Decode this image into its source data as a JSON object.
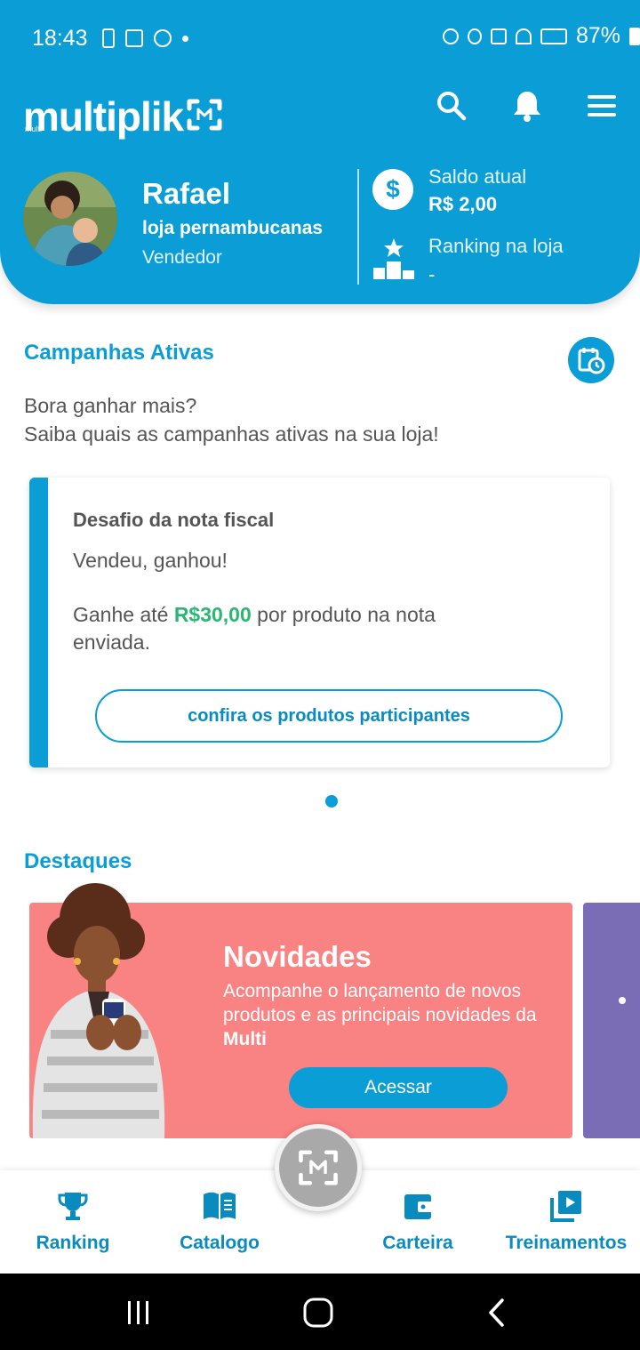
{
  "status_bar": {
    "time": "18:43",
    "battery": "87%"
  },
  "header": {
    "logo_text": "multiplik",
    "logo_sub": "multi",
    "user": {
      "name": "Rafael",
      "store": "loja pernambucanas",
      "role": "Vendedor"
    },
    "balance": {
      "label": "Saldo atual",
      "value": "R$ 2,00",
      "icon_glyph": "$"
    },
    "ranking": {
      "label": "Ranking na loja",
      "value": "-"
    },
    "colors": {
      "primary": "#0a9dd6"
    }
  },
  "campaigns": {
    "title": "Campanhas Ativas",
    "intro_line1": "Bora ganhar mais?",
    "intro_line2": "Saiba quais as campanhas ativas na sua loja!",
    "card": {
      "title": "Desafio da nota fiscal",
      "subtitle": "Vendeu, ganhou!",
      "desc_prefix": "Ganhe até ",
      "desc_highlight": "R$30,00",
      "desc_suffix": " por produto na nota enviada.",
      "button_label": "confira os produtos participantes",
      "highlight_color": "#2bb673"
    },
    "pager": {
      "current": 1,
      "total": 1
    }
  },
  "highlights": {
    "title": "Destaques",
    "banner": {
      "title": "Novidades",
      "desc_prefix": "Acompanhe o lançamento de novos produtos e as principais novidades da ",
      "desc_bold": "Multi",
      "button_label": "Acessar",
      "color": "#f98283"
    },
    "next_banner_color": "#7a6db5"
  },
  "bottom_nav": {
    "items": [
      {
        "label": "Ranking",
        "icon": "trophy-icon"
      },
      {
        "label": "Catalogo",
        "icon": "book-icon"
      },
      {
        "label": "Carteira",
        "icon": "wallet-icon"
      },
      {
        "label": "Treinamentos",
        "icon": "video-library-icon"
      }
    ],
    "fab_icon": "scan-icon"
  }
}
